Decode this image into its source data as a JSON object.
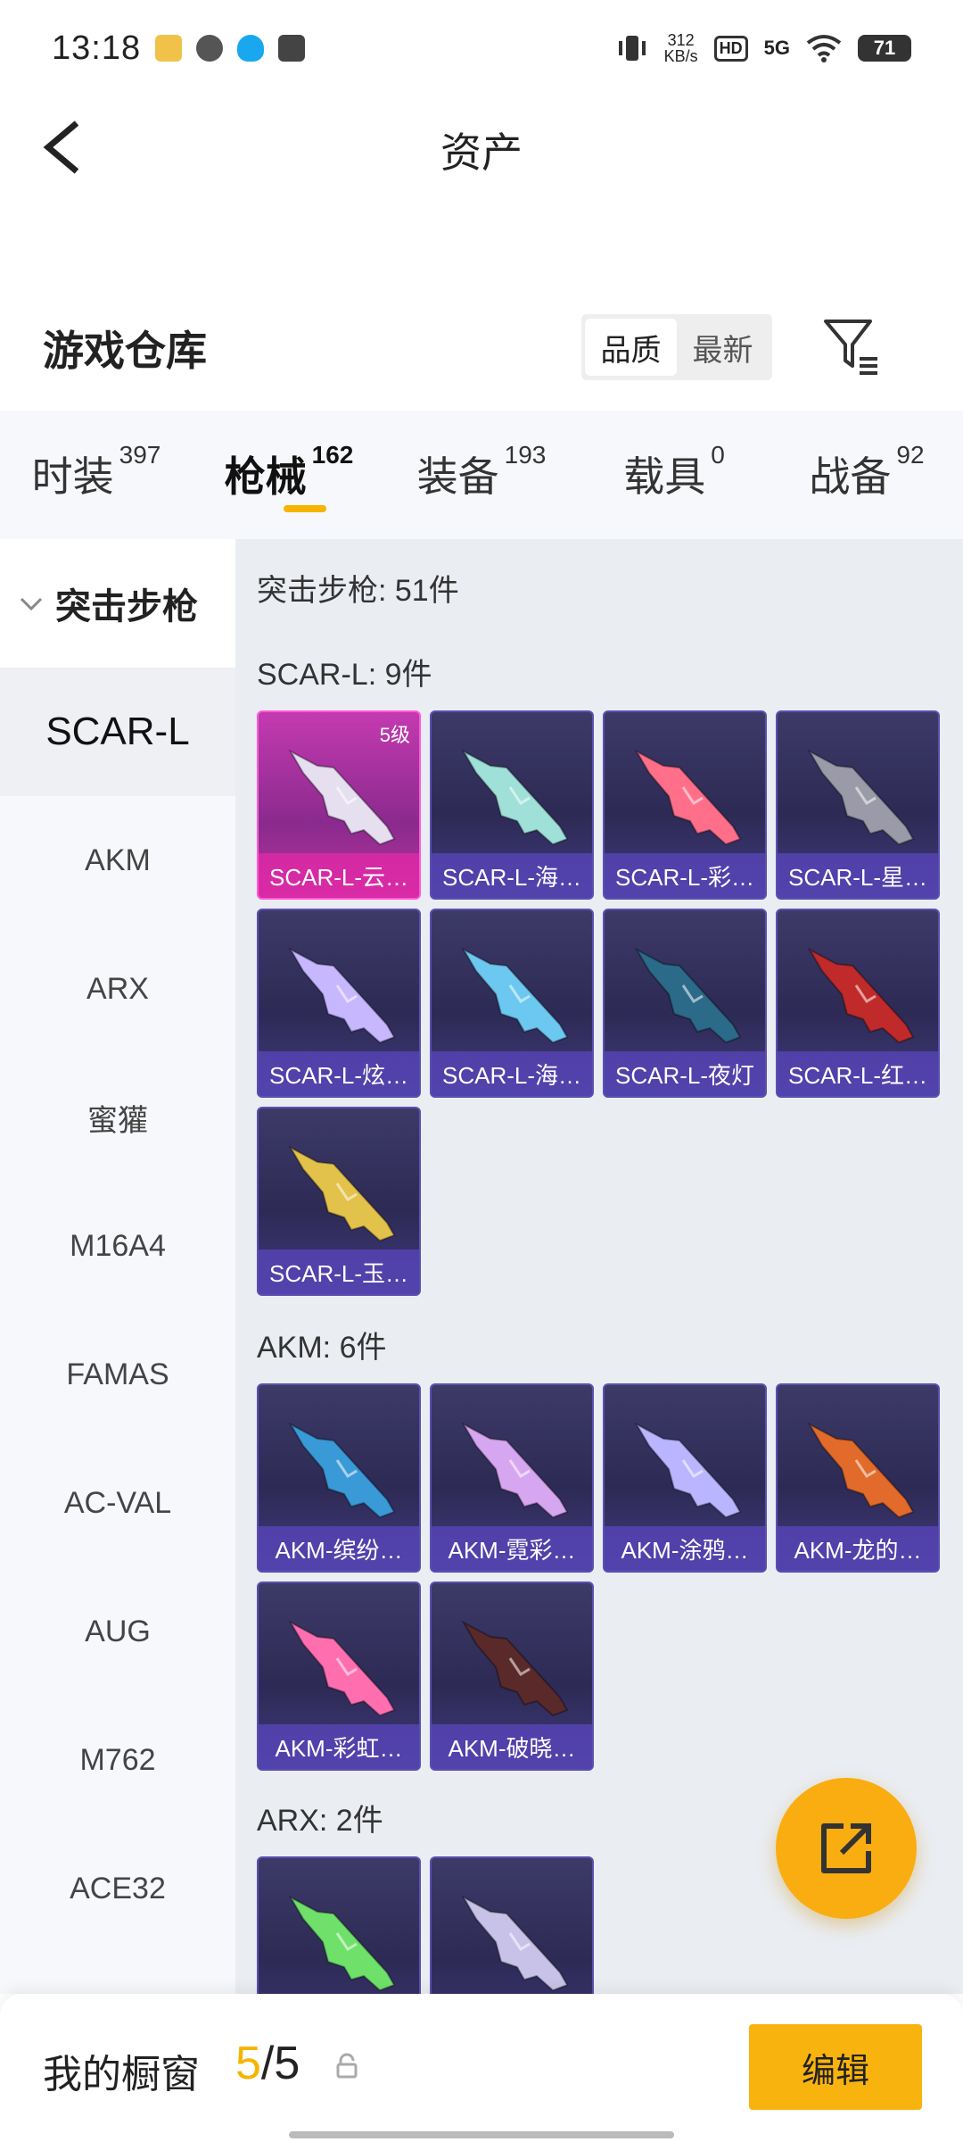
{
  "status_bar": {
    "time": "13:18",
    "net_speed_value": "312",
    "net_speed_unit": "KB/s",
    "hd_badge": "HD",
    "network": "5G",
    "battery": "71"
  },
  "header": {
    "title": "资产"
  },
  "warehouse": {
    "title": "游戏仓库",
    "sort_options": [
      "品质",
      "最新"
    ],
    "sort_selected": "品质"
  },
  "tabs": [
    {
      "label": "时装",
      "count": "397"
    },
    {
      "label": "枪械",
      "count": "162"
    },
    {
      "label": "装备",
      "count": "193"
    },
    {
      "label": "载具",
      "count": "0"
    },
    {
      "label": "战备",
      "count": "92"
    }
  ],
  "sidebar": {
    "group": "突击步枪",
    "items": [
      "SCAR-L",
      "AKM",
      "ARX",
      "蜜獾",
      "M16A4",
      "FAMAS",
      "AC-VAL",
      "AUG",
      "M762",
      "ACE32"
    ],
    "active": "SCAR-L"
  },
  "content": {
    "category_total": "突击步枪: 51件",
    "sections": [
      {
        "label": "SCAR-L: 9件",
        "items": [
          {
            "name": "SCAR-L-云…",
            "level": "5级",
            "color": "#e6dff0"
          },
          {
            "name": "SCAR-L-海…",
            "color": "#9fe0d8"
          },
          {
            "name": "SCAR-L-彩…",
            "color": "#ff6f8a"
          },
          {
            "name": "SCAR-L-星…",
            "color": "#9a9aa8"
          },
          {
            "name": "SCAR-L-炫…",
            "color": "#c7b7ff"
          },
          {
            "name": "SCAR-L-海…",
            "color": "#6cc8f0"
          },
          {
            "name": "SCAR-L-夜灯",
            "color": "#2c6a8a"
          },
          {
            "name": "SCAR-L-红…",
            "color": "#c02a2a"
          },
          {
            "name": "SCAR-L-玉…",
            "color": "#e2c24a"
          }
        ]
      },
      {
        "label": "AKM: 6件",
        "items": [
          {
            "name": "AKM-缤纷…",
            "color": "#3a9ad8"
          },
          {
            "name": "AKM-霓彩…",
            "color": "#d7a6f0"
          },
          {
            "name": "AKM-涂鸦…",
            "color": "#b9b6ff"
          },
          {
            "name": "AKM-龙的…",
            "color": "#e26a2a"
          },
          {
            "name": "AKM-彩虹…",
            "color": "#ff6fb0"
          },
          {
            "name": "AKM-破晓…",
            "color": "#5a2a2a"
          }
        ]
      },
      {
        "label": "ARX: 2件",
        "items": [
          {
            "name": "",
            "color": "#6fe06a"
          },
          {
            "name": "",
            "color": "#c9c2e8"
          }
        ]
      }
    ]
  },
  "bottom_bar": {
    "showcase_label": "我的橱窗",
    "showcase_current": "5",
    "showcase_sep": "/",
    "showcase_total": "5",
    "edit_label": "编辑"
  },
  "colors": {
    "accent": "#f6b400",
    "fab": "#f9ad11"
  }
}
